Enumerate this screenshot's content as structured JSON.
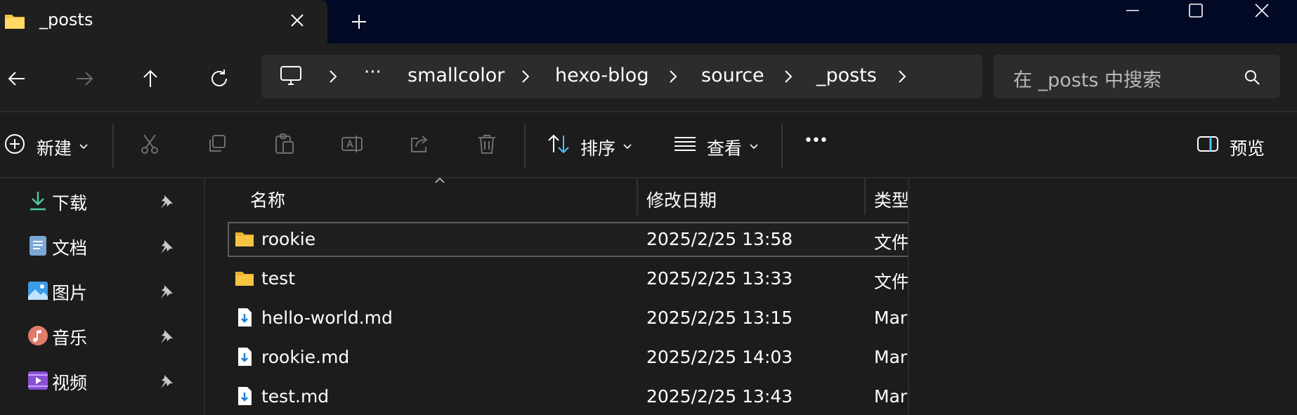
{
  "tab": {
    "title": "_posts"
  },
  "breadcrumb": {
    "items": [
      "smallcolor",
      "hexo-blog",
      "source",
      "_posts"
    ],
    "overflow": "···"
  },
  "search": {
    "placeholder": "在 _posts 中搜索"
  },
  "toolbar": {
    "new_label": "新建",
    "sort_label": "排序",
    "view_label": "查看",
    "more_label": "•••",
    "preview_label": "预览"
  },
  "sidebar": {
    "items": [
      {
        "label": "下载",
        "icon": "download-icon"
      },
      {
        "label": "文档",
        "icon": "documents-icon"
      },
      {
        "label": "图片",
        "icon": "pictures-icon"
      },
      {
        "label": "音乐",
        "icon": "music-icon"
      },
      {
        "label": "视频",
        "icon": "videos-icon"
      }
    ]
  },
  "columns": {
    "name": "名称",
    "modified": "修改日期",
    "type": "类型"
  },
  "files": [
    {
      "name": "rookie",
      "modified": "2025/2/25 13:58",
      "type": "文件夹",
      "kind": "folder",
      "selected": true
    },
    {
      "name": "test",
      "modified": "2025/2/25 13:33",
      "type": "文件夹",
      "kind": "folder"
    },
    {
      "name": "hello-world.md",
      "modified": "2025/2/25 13:15",
      "type": "Markdown",
      "kind": "md"
    },
    {
      "name": "rookie.md",
      "modified": "2025/2/25 14:03",
      "type": "Markdown",
      "kind": "md"
    },
    {
      "name": "test.md",
      "modified": "2025/2/25 13:43",
      "type": "Markdown",
      "kind": "md"
    }
  ],
  "colors": {
    "folder": "#f5c542",
    "accent": "#4cc2ff",
    "titlebar": "#020a26"
  }
}
